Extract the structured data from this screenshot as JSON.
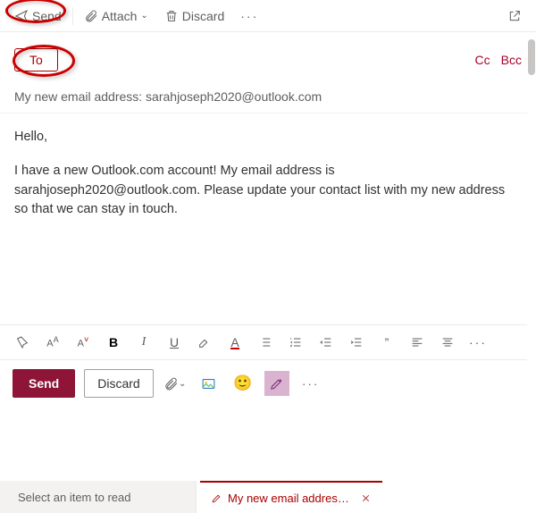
{
  "toolbar": {
    "send": "Send",
    "attach": "Attach",
    "discard": "Discard",
    "more": "···"
  },
  "recipients": {
    "to": "To",
    "cc": "Cc",
    "bcc": "Bcc"
  },
  "subject": "My new email address: sarahjoseph2020@outlook.com",
  "body": {
    "greeting": "Hello,",
    "paragraph": "I have a new Outlook.com account! My email address is sarahjoseph2020@outlook.com. Please update your contact list with my new address so that we can stay in touch."
  },
  "format": {
    "bold": "B",
    "italic": "I",
    "underline": "U",
    "fontcolor": "A",
    "quote": "”",
    "more": "···"
  },
  "actions": {
    "send": "Send",
    "discard": "Discard",
    "more": "···"
  },
  "tabs": {
    "read": "Select an item to read",
    "draft": "My new email addres…"
  },
  "icons": {
    "emoji": "🙂"
  }
}
